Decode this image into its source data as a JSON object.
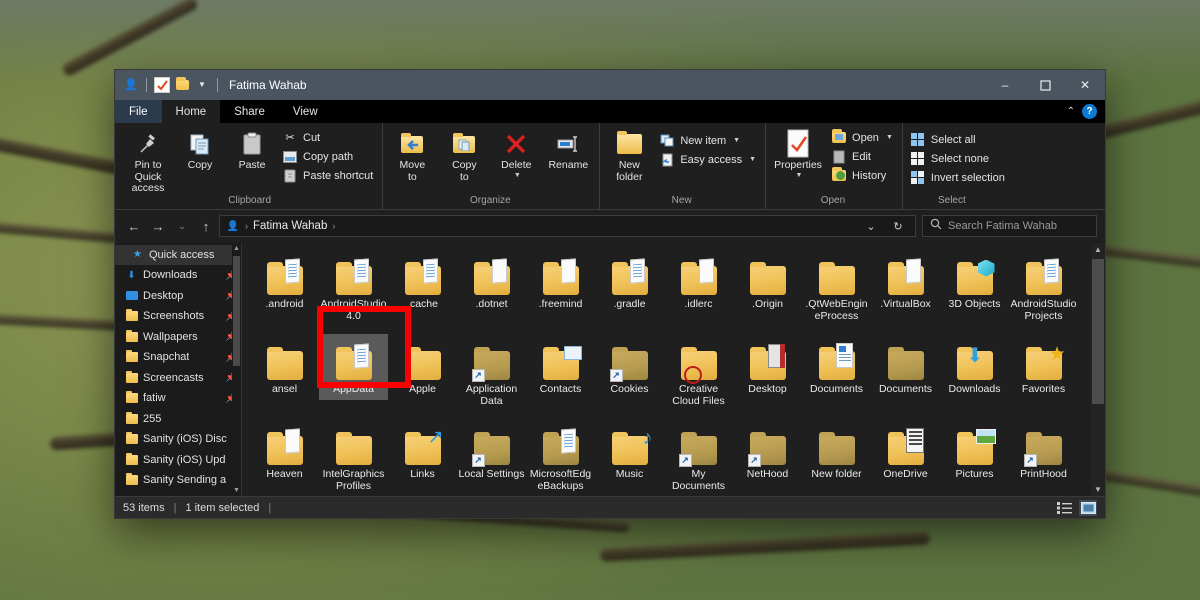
{
  "window": {
    "title": "Fatima Wahab",
    "quick_access_icons": [
      "user-icon",
      "properties-icon",
      "new-folder-icon",
      "customize-chevron-icon"
    ],
    "controls": {
      "minimize": "–",
      "maximize": "☐",
      "close": "✕"
    }
  },
  "tabs": [
    {
      "label": "File",
      "active": false,
      "kind": "file"
    },
    {
      "label": "Home",
      "active": true,
      "kind": "normal"
    },
    {
      "label": "Share",
      "active": false,
      "kind": "normal"
    },
    {
      "label": "View",
      "active": false,
      "kind": "normal"
    }
  ],
  "tabbar_right": {
    "collapse": "⌃",
    "help": "?"
  },
  "ribbon": {
    "groups": [
      {
        "label": "Clipboard",
        "big": [
          {
            "label": "Pin to Quick\naccess",
            "icon": "pin-icon"
          },
          {
            "label": "Copy",
            "icon": "copy-icon"
          },
          {
            "label": "Paste",
            "icon": "paste-icon"
          }
        ],
        "small": [
          {
            "label": "Cut",
            "icon": "scissors-icon"
          },
          {
            "label": "Copy path",
            "icon": "copy-path-icon"
          },
          {
            "label": "Paste shortcut",
            "icon": "paste-shortcut-icon"
          }
        ]
      },
      {
        "label": "Organize",
        "big": [
          {
            "label": "Move\nto",
            "icon": "move-to-icon",
            "caret": true
          },
          {
            "label": "Copy\nto",
            "icon": "copy-to-icon",
            "caret": true
          },
          {
            "label": "Delete",
            "icon": "delete-icon",
            "caret": true
          },
          {
            "label": "Rename",
            "icon": "rename-icon"
          }
        ],
        "small": []
      },
      {
        "label": "New",
        "big": [
          {
            "label": "New\nfolder",
            "icon": "new-folder-icon"
          }
        ],
        "small": [
          {
            "label": "New item",
            "icon": "new-item-icon",
            "caret": true
          },
          {
            "label": "Easy access",
            "icon": "easy-access-icon",
            "caret": true
          }
        ]
      },
      {
        "label": "Open",
        "big": [
          {
            "label": "Properties",
            "icon": "properties-icon",
            "caret": true
          }
        ],
        "small": [
          {
            "label": "Open",
            "icon": "open-icon",
            "caret": true
          },
          {
            "label": "Edit",
            "icon": "edit-icon"
          },
          {
            "label": "History",
            "icon": "history-icon"
          }
        ]
      },
      {
        "label": "Select",
        "big": [],
        "small": [
          {
            "label": "Select all",
            "icon": "select-all-icon"
          },
          {
            "label": "Select none",
            "icon": "select-none-icon"
          },
          {
            "label": "Invert selection",
            "icon": "invert-selection-icon"
          }
        ]
      }
    ]
  },
  "address": {
    "back": "←",
    "forward": "→",
    "recent": "⌄",
    "up": "↑",
    "crumbs": [
      "Fatima Wahab"
    ],
    "dropdown": "⌄",
    "refresh": "↻"
  },
  "search": {
    "placeholder": "Search Fatima Wahab",
    "icon": "search-icon"
  },
  "sidebar": {
    "items": [
      {
        "label": "Quick access",
        "icon": "star-icon",
        "selected": true,
        "root": true,
        "pinned": false
      },
      {
        "label": "Downloads",
        "icon": "download-icon",
        "selected": false,
        "root": false,
        "pinned": true
      },
      {
        "label": "Desktop",
        "icon": "desktop-icon",
        "selected": false,
        "root": false,
        "pinned": true
      },
      {
        "label": "Screenshots",
        "icon": "folder-icon",
        "selected": false,
        "root": false,
        "pinned": true
      },
      {
        "label": "Wallpapers",
        "icon": "folder-icon",
        "selected": false,
        "root": false,
        "pinned": true
      },
      {
        "label": "Snapchat",
        "icon": "folder-icon",
        "selected": false,
        "root": false,
        "pinned": true
      },
      {
        "label": "Screencasts",
        "icon": "folder-icon",
        "selected": false,
        "root": false,
        "pinned": true
      },
      {
        "label": "fatiw",
        "icon": "folder-icon",
        "selected": false,
        "root": false,
        "pinned": true
      },
      {
        "label": "255",
        "icon": "folder-icon",
        "selected": false,
        "root": false,
        "pinned": false
      },
      {
        "label": "Sanity (iOS) Disc",
        "icon": "folder-icon",
        "selected": false,
        "root": false,
        "pinned": false
      },
      {
        "label": "Sanity (iOS) Upd",
        "icon": "folder-icon",
        "selected": false,
        "root": false,
        "pinned": false
      },
      {
        "label": "Sanity Sending a",
        "icon": "folder-icon",
        "selected": false,
        "root": false,
        "pinned": false
      }
    ]
  },
  "files": [
    {
      "name": ".android",
      "icon": "folder-papers",
      "selected": false
    },
    {
      "name": "AndroidStudio4.0",
      "icon": "folder-papers",
      "selected": false
    },
    {
      "name": ".cache",
      "icon": "folder-papers",
      "selected": false
    },
    {
      "name": ".dotnet",
      "icon": "folder-papers-plain",
      "selected": false
    },
    {
      "name": ".freemind",
      "icon": "folder-papers-plain",
      "selected": false
    },
    {
      "name": ".gradle",
      "icon": "folder-papers",
      "selected": false
    },
    {
      "name": ".idlerc",
      "icon": "folder-papers-plain",
      "selected": false
    },
    {
      "name": ".Origin",
      "icon": "folder-plain",
      "selected": false
    },
    {
      "name": ".QtWebEngineProcess",
      "icon": "folder-plain",
      "selected": false
    },
    {
      "name": ".VirtualBox",
      "icon": "folder-papers-plain",
      "selected": false
    },
    {
      "name": "3D Objects",
      "icon": "folder-3d",
      "selected": false
    },
    {
      "name": "AndroidStudioProjects",
      "icon": "folder-papers",
      "selected": false
    },
    {
      "name": "ansel",
      "icon": "folder-plain",
      "selected": false
    },
    {
      "name": "AppData",
      "icon": "folder-papers",
      "selected": true
    },
    {
      "name": "Apple",
      "icon": "folder-plain",
      "selected": false
    },
    {
      "name": "Application Data",
      "icon": "folder-dark-shortcut",
      "selected": false
    },
    {
      "name": "Contacts",
      "icon": "folder-contacts",
      "selected": false
    },
    {
      "name": "Cookies",
      "icon": "folder-dark-shortcut",
      "selected": false
    },
    {
      "name": "Creative Cloud Files",
      "icon": "folder-creative-cloud",
      "selected": false
    },
    {
      "name": "Desktop",
      "icon": "folder-desktop",
      "selected": false
    },
    {
      "name": "Documents",
      "icon": "folder-documents",
      "selected": false
    },
    {
      "name": "Documents",
      "icon": "folder-dark",
      "selected": false
    },
    {
      "name": "Downloads",
      "icon": "folder-downloads",
      "selected": false
    },
    {
      "name": "Favorites",
      "icon": "folder-favorites",
      "selected": false
    },
    {
      "name": "Heaven",
      "icon": "folder-papers-plain",
      "selected": false
    },
    {
      "name": "IntelGraphicsProfiles",
      "icon": "folder-plain",
      "selected": false
    },
    {
      "name": "Links",
      "icon": "folder-links",
      "selected": false
    },
    {
      "name": "Local Settings",
      "icon": "folder-dark-shortcut",
      "selected": false
    },
    {
      "name": "MicrosoftEdgeBackups",
      "icon": "folder-dark-papers",
      "selected": false
    },
    {
      "name": "Music",
      "icon": "folder-music",
      "selected": false
    },
    {
      "name": "My Documents",
      "icon": "folder-dark-shortcut",
      "selected": false
    },
    {
      "name": "NetHood",
      "icon": "folder-dark-shortcut",
      "selected": false
    },
    {
      "name": "New folder",
      "icon": "folder-dark",
      "selected": false
    },
    {
      "name": "OneDrive",
      "icon": "folder-onedrive",
      "selected": false
    },
    {
      "name": "Pictures",
      "icon": "folder-pictures",
      "selected": false
    },
    {
      "name": "PrintHood",
      "icon": "folder-dark-shortcut",
      "selected": false
    }
  ],
  "files_partial_row": [
    {
      "icon": "clock-folder"
    },
    {
      "icon": "folder-plain"
    },
    {
      "icon": "folder-plain"
    },
    {
      "icon": "folder-dark"
    },
    {
      "icon": "folder-dark"
    },
    {
      "icon": "folder-dark"
    },
    {
      "icon": "folder-store"
    },
    {
      "icon": "folder-plain"
    },
    {
      "icon": "doc-white"
    },
    {
      "icon": "doc-white"
    },
    {
      "icon": "doc-blue"
    },
    {
      "icon": "doc-gray"
    }
  ],
  "status": {
    "item_count": "53 items",
    "selection": "1 item selected",
    "view_buttons": [
      "details-view-icon",
      "large-icons-view-icon"
    ]
  }
}
